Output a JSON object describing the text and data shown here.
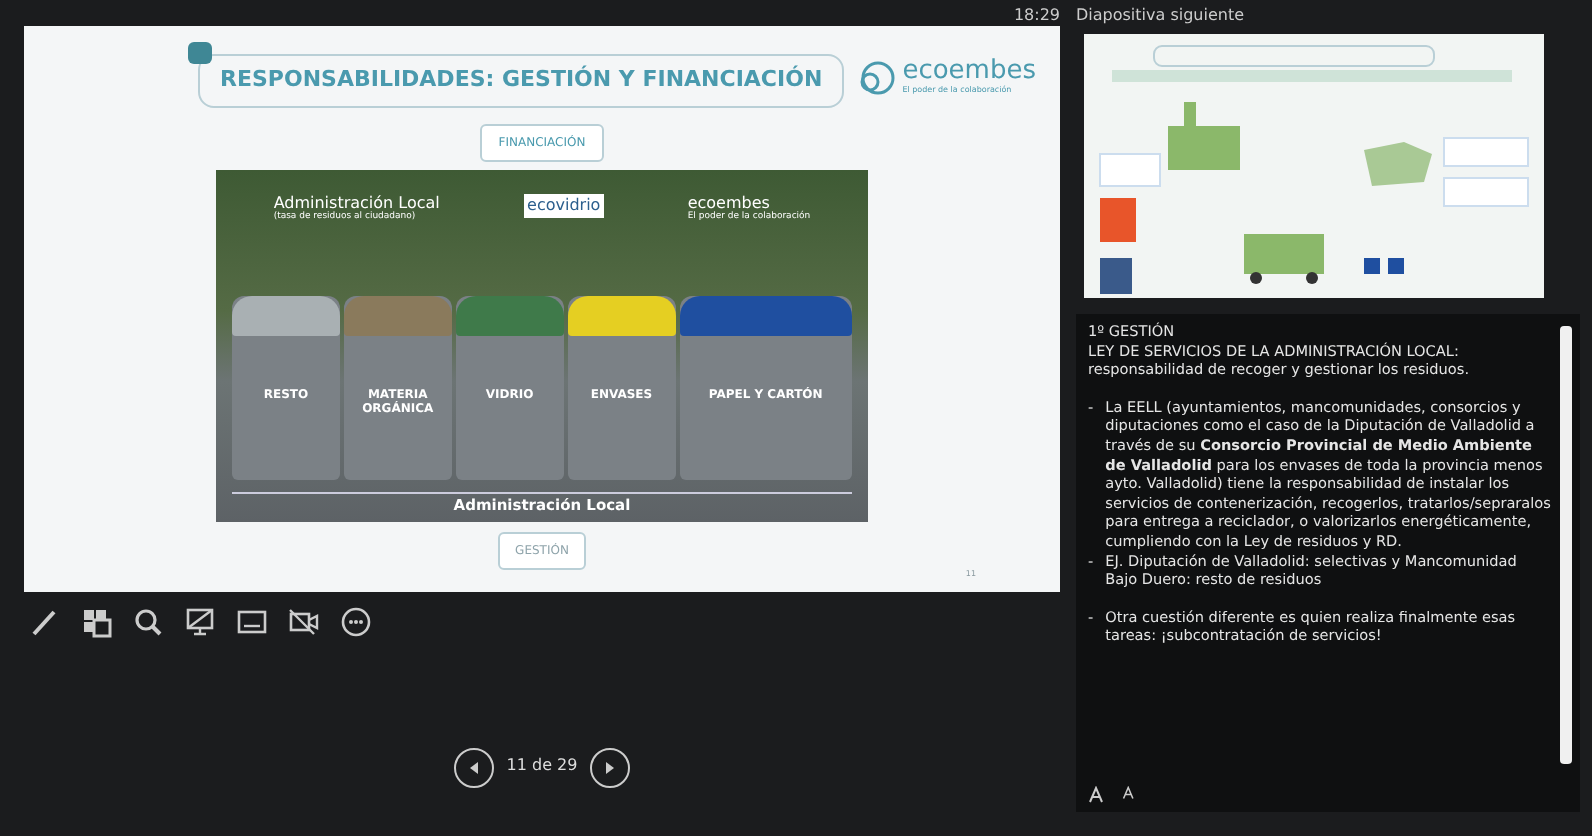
{
  "clock": "18:29",
  "slide": {
    "title": "RESPONSABILIDADES: GESTIÓN Y FINANCIACIÓN",
    "logo": {
      "name": "ecoembes",
      "tagline": "El poder de la colaboración"
    },
    "top_button": "FINANCIACIÓN",
    "photo": {
      "header_labels": [
        {
          "kind": "admin",
          "text": "Administración Local",
          "subtext": "(tasa de residuos al ciudadano)"
        },
        {
          "kind": "boxed",
          "text": "ecovidrio"
        },
        {
          "kind": "logo",
          "text": "ecoembes",
          "subtext": "El poder de la colaboración"
        }
      ],
      "bins": [
        {
          "label": "RESTO",
          "color": "#a9b0b3"
        },
        {
          "label": "MATERIA ORGÁNICA",
          "color": "#8a7a5c"
        },
        {
          "label": "VIDRIO",
          "color": "#3f7a4a"
        },
        {
          "label": "ENVASES",
          "color": "#e5cf22"
        },
        {
          "label": "PAPEL Y CARTÓN",
          "color": "#1f4fa0"
        }
      ],
      "footer_label": "Administración Local"
    },
    "bottom_button": "GESTIÓN",
    "number": "11"
  },
  "navigation": {
    "position": "11 de 29"
  },
  "next_slide": {
    "label": "Diapositiva siguiente"
  },
  "notes": {
    "items": [
      {
        "kind": "text",
        "text": "1º GESTIÓN"
      },
      {
        "kind": "text",
        "text": "LEY DE SERVICIOS DE LA ADMINISTRACIÓN LOCAL:"
      },
      {
        "kind": "text",
        "text": "responsabilidad de recoger y gestionar los residuos."
      },
      {
        "kind": "blank"
      },
      {
        "kind": "bullet",
        "marker": "-",
        "text": "La EELL (ayuntamientos, mancomunidades, consorcios y diputaciones como el caso de la Diputación de Valladolid a través de su **Consorcio Provincial de Medio Ambiente de Valladolid** para los envases de toda la provincia menos ayto. Valladolid) tiene la responsabilidad de instalar los servicios de contenerización, recogerlos, tratarlos/sepraralos para entrega a reciclador, o valorizarlos energéticamente, cumpliendo con la Ley de residuos y RD."
      },
      {
        "kind": "bullet",
        "marker": "-",
        "text": "EJ. Diputación de Valladolid: selectivas y Mancomunidad Bajo Duero: resto de residuos"
      },
      {
        "kind": "blank"
      },
      {
        "kind": "bullet",
        "marker": "-",
        "text": "Otra cuestión diferente es quien realiza finalmente esas tareas: ¡subcontratación de servicios!"
      }
    ]
  }
}
